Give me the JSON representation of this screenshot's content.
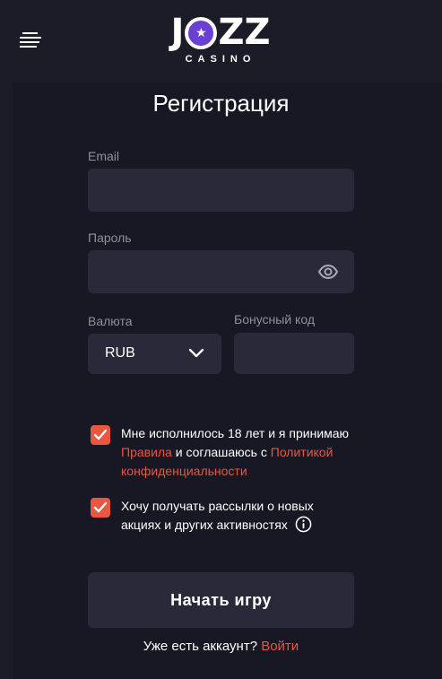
{
  "header": {
    "menu_icon": "hamburger-menu-icon",
    "logo_text": "JOZZ",
    "logo_subtext": "CASINO"
  },
  "form": {
    "title": "Регистрация",
    "email": {
      "label": "Email",
      "value": "",
      "placeholder": ""
    },
    "password": {
      "label": "Пароль",
      "value": "",
      "placeholder": "",
      "icon": "eye-icon"
    },
    "currency": {
      "label": "Валюта",
      "selected": "RUB",
      "icon": "chevron-down-icon"
    },
    "bonus_code": {
      "label": "Бонусный код",
      "value": "",
      "placeholder": ""
    },
    "terms": {
      "checked": true,
      "text_before": "Мне исполнилось 18 лет и я принимаю",
      "rules_link": "Правила",
      "text_middle": " и соглашаюсь с ",
      "privacy_link_part1": "Политикой",
      "privacy_link_part2": "конфиденциальности"
    },
    "newsletter": {
      "checked": true,
      "line1": "Хочу получать рассылки о новых",
      "line2": "акциях и других активностях",
      "icon": "info-icon"
    },
    "submit_label": "Начать игру",
    "footer_text": "Уже есть аккаунт? ",
    "login_link": "Войти"
  },
  "colors": {
    "background": "#1c1b28",
    "panel": "#181824",
    "field": "#2a2939",
    "accent": "#e8573f",
    "muted_text": "#8f8f9e"
  }
}
